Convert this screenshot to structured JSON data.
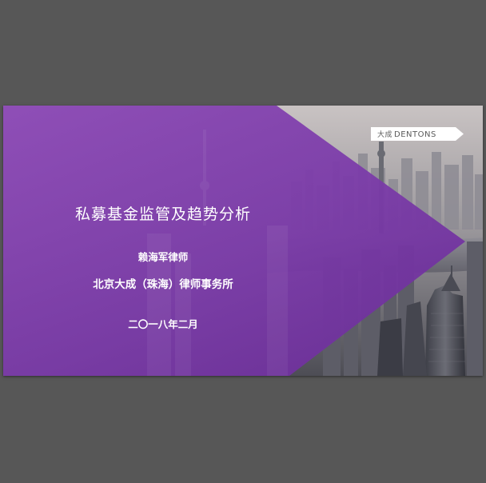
{
  "slide": {
    "title": "私募基金监管及趋势分析",
    "presenter": "赖海军律师",
    "firm": "北京大成（珠海）律师事务所",
    "date": "二〇一八年二月",
    "logo": {
      "chinese": "大成",
      "brand": "DENTONS"
    }
  },
  "colors": {
    "viewer_background": "#575757",
    "brand_purple": "#7d3ea8",
    "text": "#ffffff"
  }
}
